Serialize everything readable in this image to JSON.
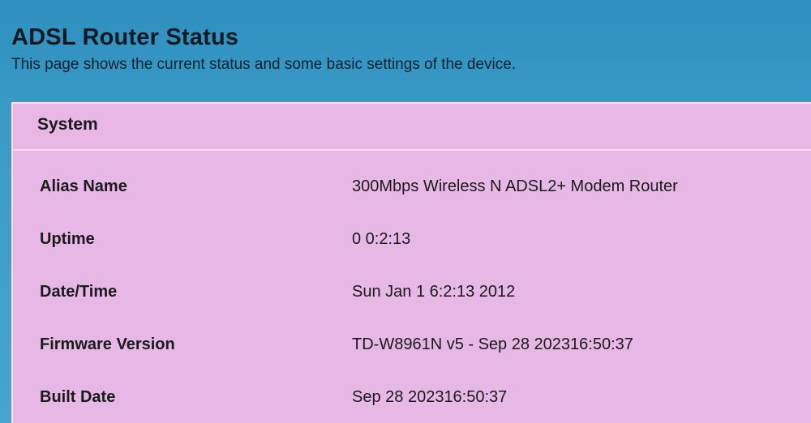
{
  "page": {
    "title": "ADSL Router Status",
    "description": "This page shows the current status and some basic settings of the device."
  },
  "system": {
    "section_title": "System",
    "rows": [
      {
        "label": "Alias Name",
        "value": "300Mbps Wireless N ADSL2+ Modem Router"
      },
      {
        "label": "Uptime",
        "value": "0 0:2:13"
      },
      {
        "label": "Date/Time",
        "value": "Sun Jan 1 6:2:13 2012"
      },
      {
        "label": "Firmware Version",
        "value": "TD-W8961N v5 - Sep 28 202316:50:37"
      },
      {
        "label": "Built Date",
        "value": "Sep 28 202316:50:37"
      }
    ]
  }
}
